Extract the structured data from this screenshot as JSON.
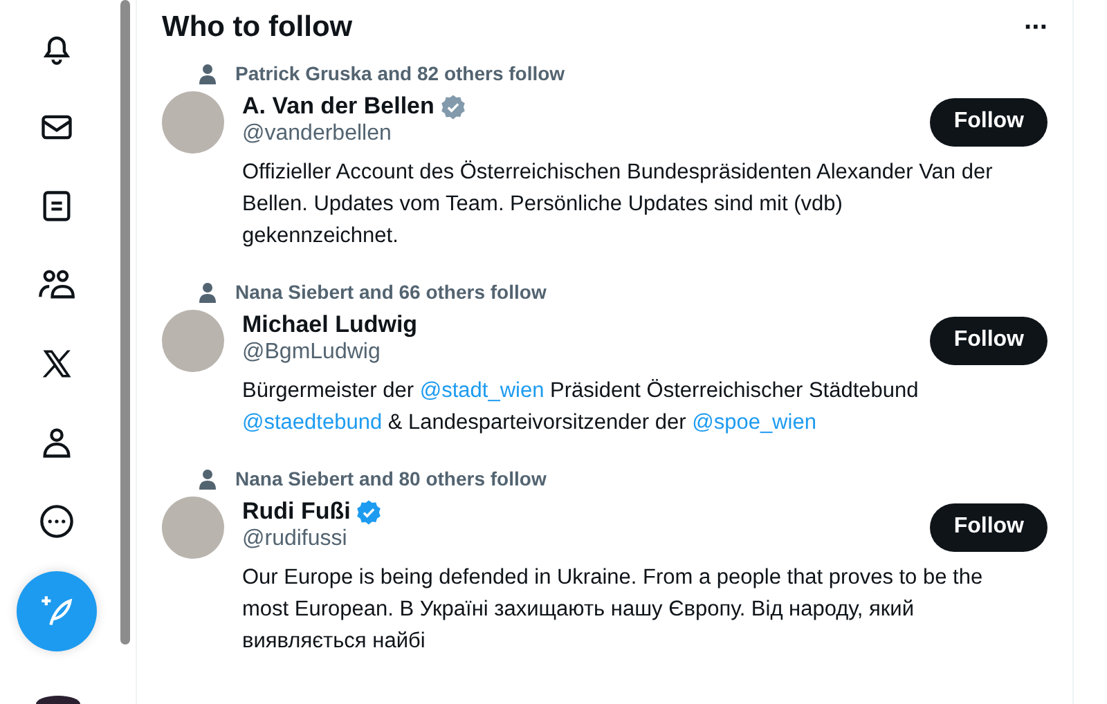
{
  "sidebar": {
    "items": [
      {
        "kind": "bell"
      },
      {
        "kind": "mail"
      },
      {
        "kind": "list"
      },
      {
        "kind": "people"
      },
      {
        "kind": "logo"
      },
      {
        "kind": "profile"
      },
      {
        "kind": "more"
      }
    ],
    "compose": {
      "kind": "post"
    }
  },
  "panel": {
    "title": "Who to follow",
    "menu": "···"
  },
  "users": [
    {
      "context": "Patrick Gruska and 82 others follow",
      "name": "A. Van der Bellen",
      "color": "#829aab",
      "handle": "@vanderbellen",
      "button": "Follow",
      "bio": [
        {
          "kind": "text",
          "text": "Offizieller Account des Österreichischen Bundespräsidenten Alexander Van der Bellen. Updates vom Team. Persönliche Updates sind mit (vdb) gekennzeichnet."
        }
      ]
    },
    {
      "context": "Nana Siebert and 66 others follow",
      "name": "Michael Ludwig",
      "handle": "@BgmLudwig",
      "button": "Follow",
      "bio": [
        {
          "kind": "text",
          "text": "Bürgermeister der "
        },
        {
          "kind": "mention",
          "text": "@stadt_wien"
        },
        {
          "kind": "text",
          "text": " Präsident Österreichischer Städtebund "
        },
        {
          "kind": "mention",
          "text": "@staedtebund"
        },
        {
          "kind": "text",
          "text": " & Landesparteivorsitzender der "
        },
        {
          "kind": "mention",
          "text": "@spoe_wien"
        }
      ]
    },
    {
      "context": "Nana Siebert and 80 others follow",
      "name": "Rudi Fußi",
      "color": "#1d9bf0",
      "handle": "@rudifussi",
      "button": "Follow",
      "bio": [
        {
          "kind": "text",
          "text": "Our Europe is being defended in Ukraine. From a people that proves to be the most European. В Україні захищають нашу Європу. Від народу, який виявляється найбі"
        }
      ]
    }
  ]
}
